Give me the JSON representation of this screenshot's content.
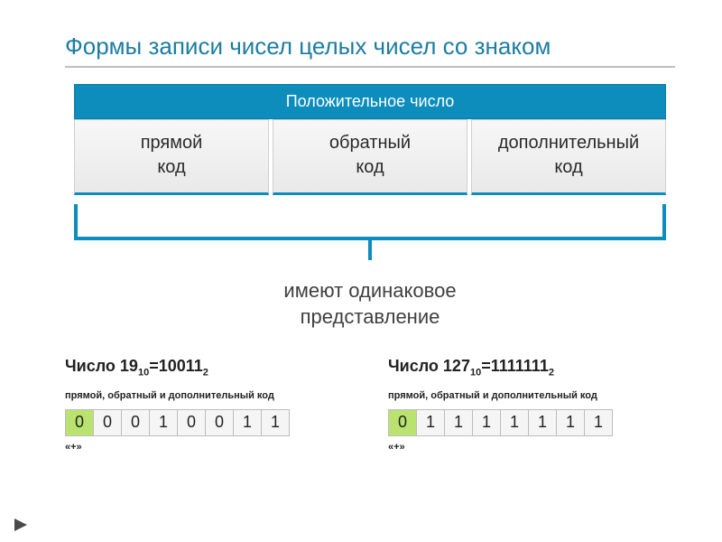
{
  "title": "Формы записи чисел целых чисел со знаком",
  "header": "Положительное число",
  "cols": {
    "c1a": "прямой",
    "c1b": "код",
    "c2a": "обратный",
    "c2b": "код",
    "c3a": "дополнительный",
    "c3b": "код"
  },
  "bracket_label_1": "имеют одинаковое",
  "bracket_label_2": "представление",
  "ex1": {
    "title_a": "Число 19",
    "title_b": "=10011",
    "sub_base1": "10",
    "sub_base2": "2",
    "sub": "прямой, обратный и дополнительный код",
    "bits": [
      "0",
      "0",
      "0",
      "1",
      "0",
      "0",
      "1",
      "1"
    ],
    "sign": "«+»"
  },
  "ex2": {
    "title_a": "Число 127",
    "title_b": "=1111111",
    "sub_base1": "10",
    "sub_base2": "2",
    "sub": "прямой, обратный и дополнительный код",
    "bits": [
      "0",
      "1",
      "1",
      "1",
      "1",
      "1",
      "1",
      "1"
    ],
    "sign": "«+»"
  }
}
